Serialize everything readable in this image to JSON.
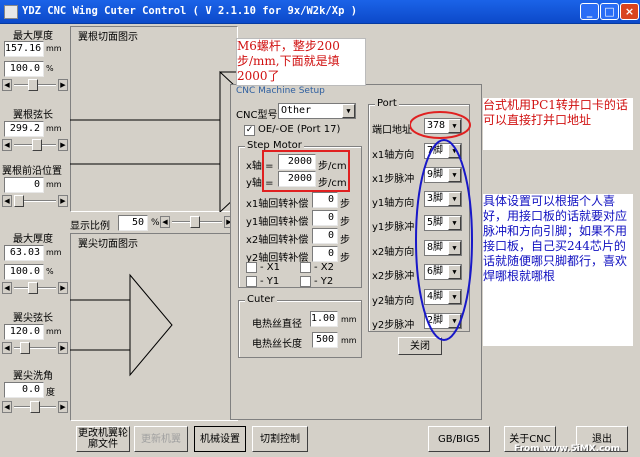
{
  "titlebar": {
    "title": "YDZ CNC Wing Cuter Control ( V 2.1.10 for 9x/W2k/Xp )"
  },
  "left": {
    "max_thickness_label": "最大厚度",
    "max_thickness_top": "157.16",
    "unit_mm": "mm",
    "pct_top": "100.0",
    "unit_pct": "%",
    "root_chord_label": "翼根弦长",
    "root_chord": "299.2",
    "root_lead_label": "翼根前沿位置",
    "root_lead": "0",
    "max_thickness2": "63.03",
    "pct_mid": "100.0",
    "tip_chord_label": "翼尖弦长",
    "tip_chord": "120.0",
    "tip_wash_label": "翼尖洗角",
    "tip_wash": "0.0",
    "unit_deg": "度"
  },
  "main": {
    "root_section_label": "翼根切面图示",
    "scale_label": "显示比例",
    "scale_value": "50",
    "scale_unit": "%",
    "tip_section_label": "翼尖切面图示"
  },
  "setup": {
    "title": "CNC Machine Setup",
    "cnc_type_label": "CNC型号",
    "cnc_type_value": "Other",
    "oe_label": "OE/-OE (Port 17)",
    "step_motor_title": "Step Motor",
    "x_label": "x轴 =",
    "x_value": "2000",
    "y_label": "y轴 =",
    "y_value": "2000",
    "step_unit": "步/cm",
    "x1_comp_label": "x1轴回转补偿",
    "x1_comp": "0",
    "y1_comp_label": "y1轴回转补偿",
    "y1_comp": "0",
    "x2_comp_label": "x2轴回转补偿",
    "x2_comp": "0",
    "y2_comp_label": "y2轴回转补偿",
    "y2_comp": "0",
    "comp_unit": "步",
    "chk_x1": "- X1",
    "chk_x2": "- X2",
    "chk_y1": "- Y1",
    "chk_y2": "- Y2",
    "cuter_title": "Cuter",
    "wire_dia_label": "电热丝直径",
    "wire_dia": "1.00",
    "wire_len_label": "电热丝长度",
    "wire_len": "500",
    "port_title": "Port",
    "port_addr_label": "端口地址",
    "port_addr": "378",
    "x1_dir_label": "x1轴方向",
    "x1_dir": "7脚",
    "x1_step_label": "x1步脉冲",
    "x1_step": "9脚",
    "y1_dir_label": "y1轴方向",
    "y1_dir": "3脚",
    "y1_step_label": "y1步脉冲",
    "y1_step": "5脚",
    "x2_dir_label": "x2轴方向",
    "x2_dir": "8脚",
    "x2_step_label": "x2步脉冲",
    "x2_step": "6脚",
    "y2_dir_label": "y2轴方向",
    "y2_dir": "4脚",
    "y2_step_label": "y2步脉冲",
    "y2_step": "2脚",
    "close_label": "关闭"
  },
  "annotations": {
    "m6": "M6螺杆，整步200步/mm,下面就是填2000了",
    "pc1": "台式机用PC1转并口卡的话可以直接打并口地址",
    "detail": "具体设置可以根据个人喜好，用接口板的话就要对应脉冲和方向引脚；如果不用接口板，自己买244芯片的话就随便哪只脚都行，喜欢焊哪根就哪根"
  },
  "bottom": {
    "btn1": "更改机翼轮廓文件",
    "btn2": "更新机翼",
    "btn3": "机械设置",
    "btn4": "切割控制",
    "btn5": "GB/BIG5",
    "btn6": "关于CNC",
    "btn7": "退出",
    "watermark": "From www.5iMX.com"
  },
  "colors": {
    "title_blue": "#0c49c9",
    "annotation_red": "#d01010",
    "annotation_blue": "#1010c0"
  }
}
